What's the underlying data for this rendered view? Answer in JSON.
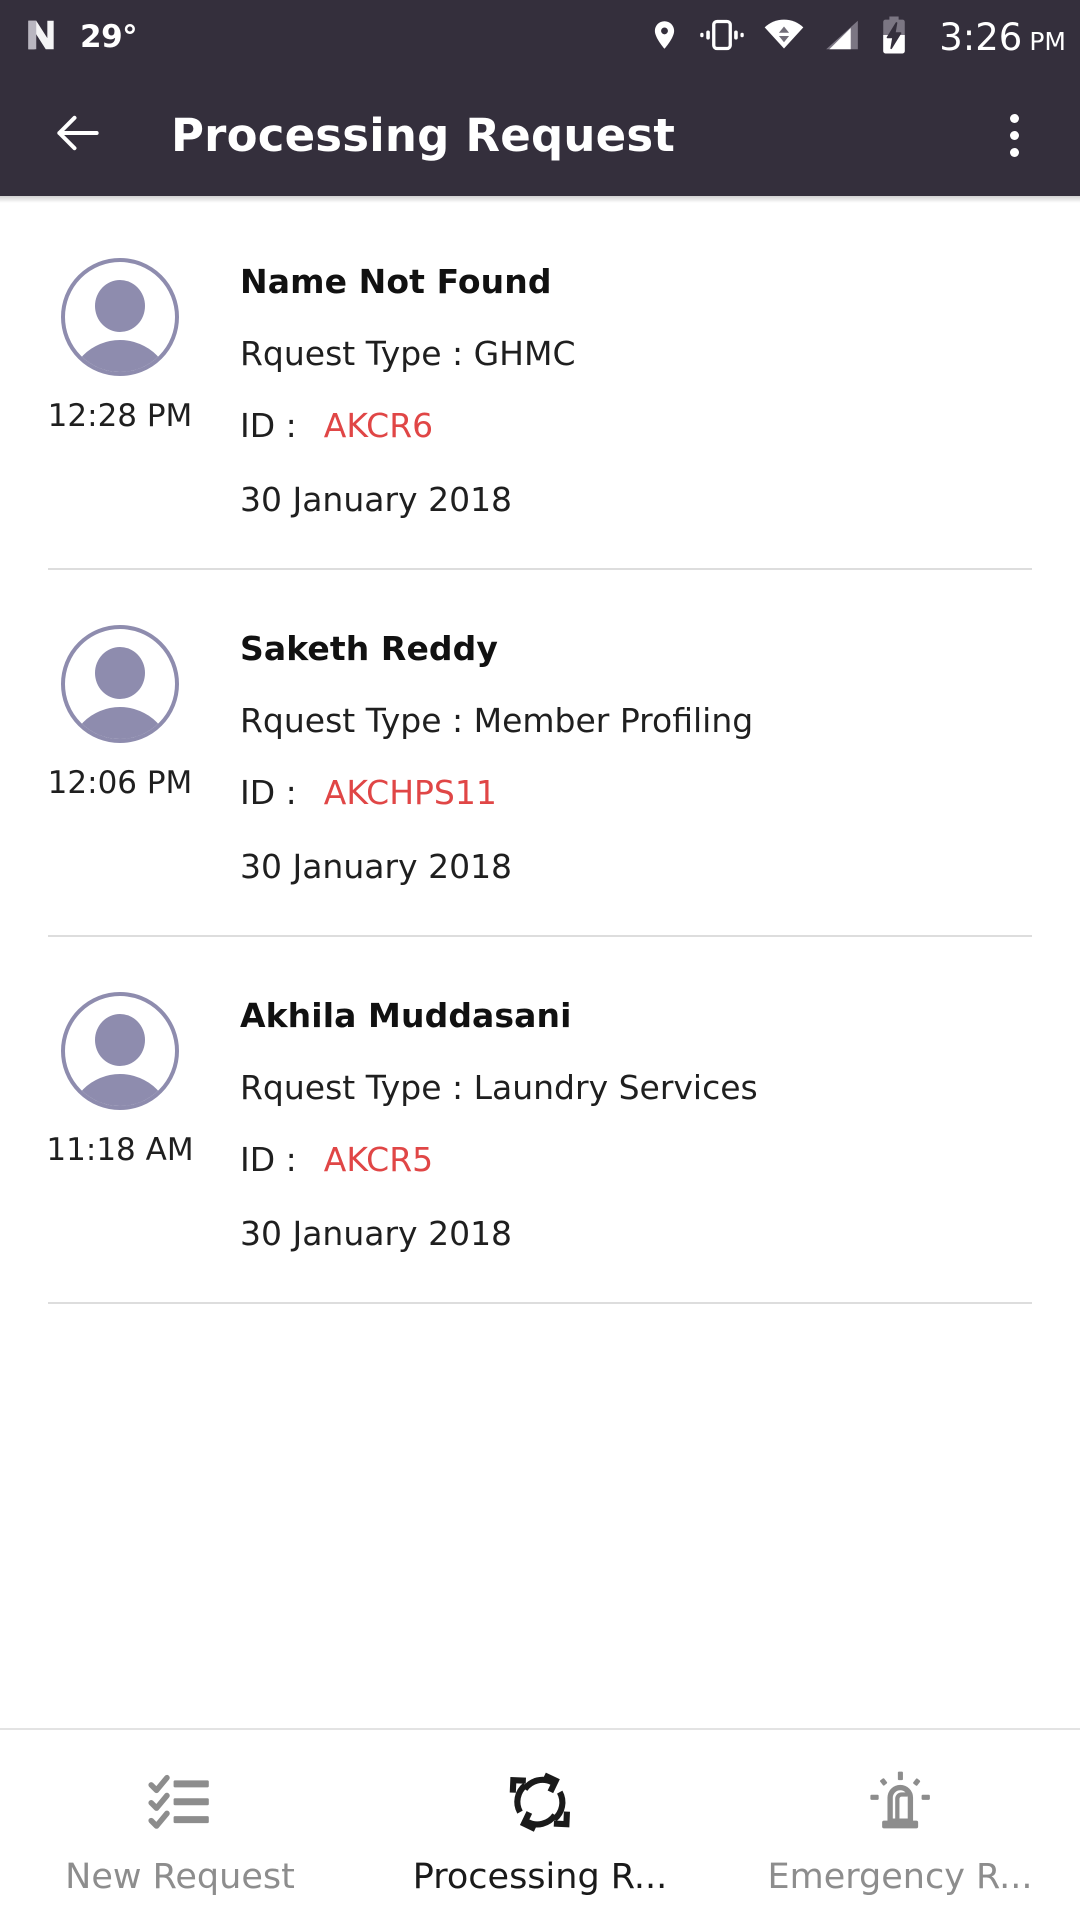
{
  "status_bar": {
    "notification_icon": "android-n-logo-icon",
    "temperature": "29°",
    "icons": [
      "location-pin-icon",
      "vibrate-icon",
      "wifi-icon",
      "cellular-signal-icon",
      "battery-charging-icon"
    ],
    "time": "3:26",
    "am_pm": "PM"
  },
  "app_bar": {
    "back_icon": "back-arrow-icon",
    "title": "Processing Request",
    "overflow_icon": "overflow-menu-icon",
    "background_color": "#342f3c",
    "text_color": "#ffffff"
  },
  "colors": {
    "id_accent": "#e04646",
    "avatar": "#8e8cae",
    "divider": "#dddddd",
    "inactive_tab": "#8d8d8d",
    "active_tab": "#1a1a1a"
  },
  "labels": {
    "request_type_prefix": "Rquest Type :",
    "id_prefix": "ID :"
  },
  "requests": [
    {
      "avatar_icon": "person-avatar-icon",
      "time": "12:28 PM",
      "name": "Name Not Found",
      "request_type_line": "Rquest Type : GHMC",
      "request_type": "GHMC",
      "id_label": "ID :",
      "id_value": "AKCR6",
      "date": "30 January 2018"
    },
    {
      "avatar_icon": "person-avatar-icon",
      "time": "12:06 PM",
      "name": "Saketh Reddy",
      "request_type_line": "Rquest Type : Member Profiling",
      "request_type": "Member Profiling",
      "id_label": "ID :",
      "id_value": "AKCHPS11",
      "date": "30 January 2018"
    },
    {
      "avatar_icon": "person-avatar-icon",
      "time": "11:18 AM",
      "name": "Akhila Muddasani",
      "request_type_line": "Rquest Type : Laundry Services",
      "request_type": "Laundry Services",
      "id_label": "ID :",
      "id_value": "AKCR5",
      "date": "30 January 2018"
    }
  ],
  "bottom_nav": {
    "tabs": [
      {
        "label": "New Request",
        "icon": "checklist-icon",
        "active": false
      },
      {
        "label": "Processing R...",
        "icon": "sync-refresh-icon",
        "active": true
      },
      {
        "label": "Emergency R...",
        "icon": "siren-alarm-icon",
        "active": false
      }
    ]
  }
}
